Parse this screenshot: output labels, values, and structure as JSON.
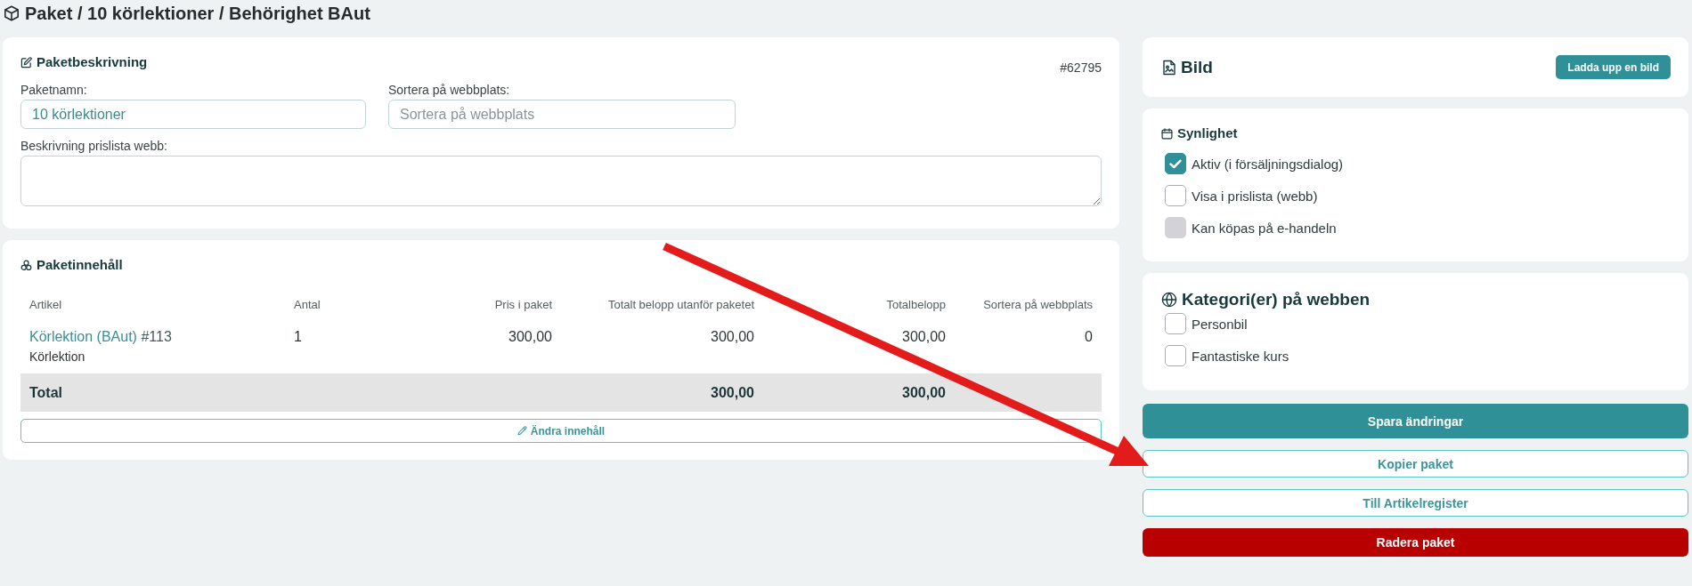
{
  "page": {
    "title": "Paket / 10 körlektioner / Behörighet BAut"
  },
  "description_card": {
    "title": "Paketbeskrivning",
    "id": "#62795",
    "fields": [
      {
        "label": "Paketnamn:",
        "value": "10 körlektioner"
      },
      {
        "label": "Sortera på webbplats:",
        "placeholder": "Sortera på webbplats"
      }
    ],
    "textarea": {
      "label": "Beskrivning prislista webb:"
    }
  },
  "content_card": {
    "title": "Paketinnehåll",
    "table": {
      "columns": [
        "Artikel",
        "Antal",
        "Pris i paket",
        "Totalt belopp utanför paketet",
        "Totalbelopp",
        "Sortera på webbplats"
      ],
      "rows": [
        {
          "article": "Körlektion (BAut)",
          "article_number": "#113",
          "subtitle": "Körlektion",
          "quantity": "1",
          "price": "300,00",
          "total_outside": "300,00",
          "total": "300,00",
          "sort": "0"
        }
      ],
      "total_row": {
        "label": "Total",
        "total_outside": "300,00",
        "total": "300,00"
      }
    },
    "edit_button": "Ändra innehåll"
  },
  "image_card": {
    "title": "Bild",
    "upload_button": "Ladda upp en bild"
  },
  "visibility_card": {
    "title": "Synlighet",
    "options": [
      {
        "label": "Aktiv (i försäljningsdialog)",
        "checked": true,
        "disabled": false
      },
      {
        "label": "Visa i prislista (webb)",
        "checked": false,
        "disabled": false
      },
      {
        "label": "Kan köpas på e-handeln",
        "checked": false,
        "disabled": true
      }
    ]
  },
  "categories_card": {
    "title": "Kategori(er) på webben",
    "options": [
      {
        "label": "Personbil",
        "checked": false
      },
      {
        "label": "Fantastiske kurs",
        "checked": false
      }
    ]
  },
  "actions": [
    {
      "label": "Spara ändringar",
      "kind": "primary"
    },
    {
      "label": "Kopier paket",
      "kind": "outline"
    },
    {
      "label": "Till Artikelregister",
      "kind": "outline"
    },
    {
      "label": "Radera paket",
      "kind": "danger"
    }
  ]
}
